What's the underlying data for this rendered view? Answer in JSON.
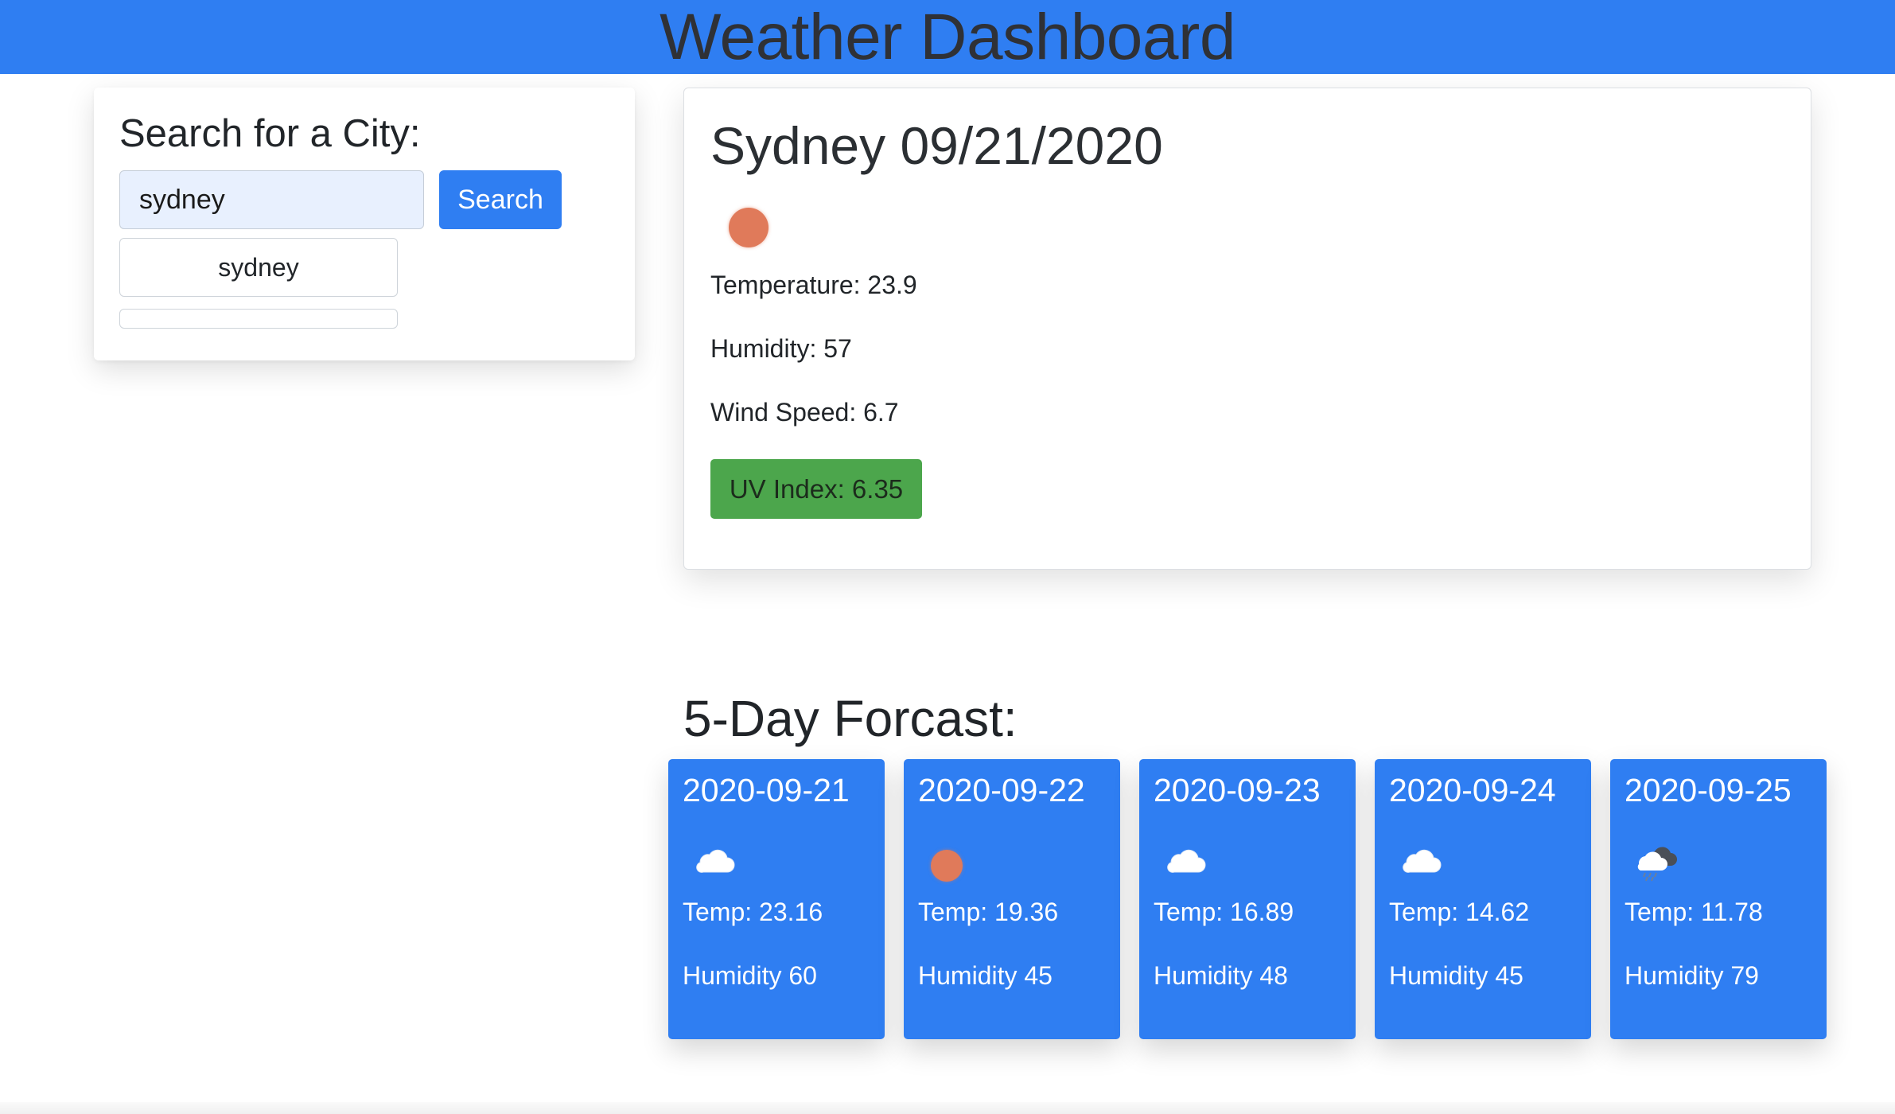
{
  "header": {
    "title": "Weather Dashboard"
  },
  "search": {
    "title": "Search for a City:",
    "input_value": "sydney",
    "button_label": "Search",
    "history": [
      "sydney",
      ""
    ]
  },
  "current": {
    "title": "Sydney 09/21/2020",
    "icon": "sun-icon",
    "temperature": "Temperature: 23.9",
    "humidity": "Humidity: 57",
    "wind": "Wind Speed: 6.7",
    "uv": "UV Index: 6.35",
    "uv_color": "#4ca64c"
  },
  "forecast": {
    "title": "5-Day Forcast:",
    "days": [
      {
        "date": "2020-09-21",
        "icon": "cloud-icon",
        "temp": "Temp: 23.16",
        "humidity": "Humidity 60"
      },
      {
        "date": "2020-09-22",
        "icon": "sun-icon",
        "temp": "Temp: 19.36",
        "humidity": "Humidity 45"
      },
      {
        "date": "2020-09-23",
        "icon": "cloud-icon",
        "temp": "Temp: 16.89",
        "humidity": "Humidity 48"
      },
      {
        "date": "2020-09-24",
        "icon": "cloud-icon",
        "temp": "Temp: 14.62",
        "humidity": "Humidity 45"
      },
      {
        "date": "2020-09-25",
        "icon": "rain-cloud-icon",
        "temp": "Temp: 11.78",
        "humidity": "Humidity 79"
      }
    ]
  },
  "colors": {
    "accent": "#2f7ef2",
    "sun": "#e07a5a",
    "uv_badge": "#4ca64c"
  }
}
